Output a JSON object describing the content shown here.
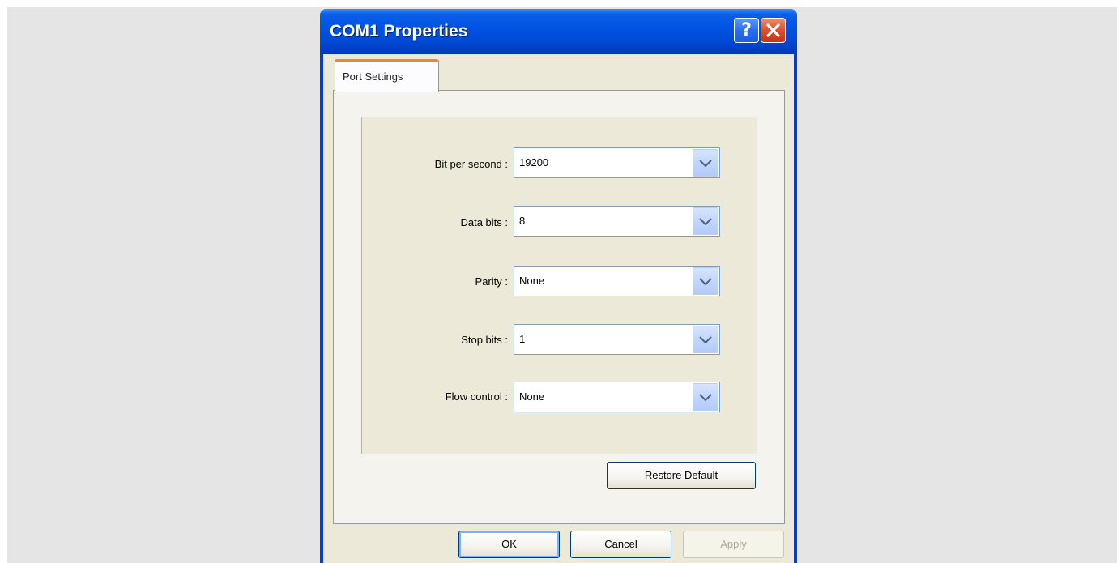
{
  "dialog": {
    "title": "COM1 Properties",
    "help_symbol": "?",
    "close_symbol": "✕"
  },
  "tabs": [
    {
      "label": "Port Settings",
      "selected": true
    }
  ],
  "fields": [
    {
      "label": "Bit per second :",
      "value": "19200"
    },
    {
      "label": "Data bits :",
      "value": "8"
    },
    {
      "label": "Parity :",
      "value": "None"
    },
    {
      "label": "Stop bits :",
      "value": "1"
    },
    {
      "label": "Flow control :",
      "value": "None"
    }
  ],
  "buttons": {
    "restore_default": "Restore Default",
    "ok": "OK",
    "cancel": "Cancel",
    "apply": "Apply"
  },
  "colors": {
    "titlebar": "#0054e3",
    "dialog_face": "#ece9d8",
    "tab_accent": "#e68b2c",
    "close_button": "#d9512c"
  },
  "icons": {
    "help": "help-icon",
    "close": "close-icon",
    "dropdown": "chevron-down-icon"
  }
}
